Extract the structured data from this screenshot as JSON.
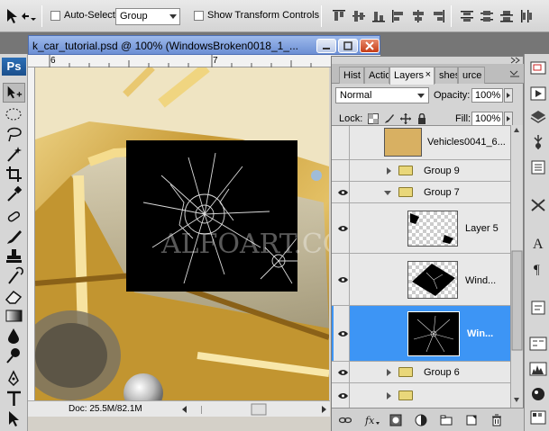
{
  "options_bar": {
    "auto_select_label": "Auto-Select:",
    "auto_select_value": "Group",
    "show_transform_label": "Show Transform Controls"
  },
  "toolbox": {
    "logo_text": "Ps"
  },
  "document": {
    "title": "k_car_tutorial.psd @ 100% (WindowsBroken0018_1_...",
    "ruler_marks": [
      "6",
      "7"
    ],
    "status": "Doc: 25.5M/82.1M",
    "watermark": "ALFOART.COM"
  },
  "panel": {
    "tabs": [
      "Hist",
      "Actio",
      "Layers",
      "shes",
      "urce"
    ],
    "blend_mode": "Normal",
    "opacity_label": "Opacity:",
    "opacity_value": "100%",
    "lock_label": "Lock:",
    "fill_label": "Fill:",
    "fill_value": "100%",
    "layers": [
      {
        "name": "Vehicles0041_6...",
        "visible": false,
        "kind": "layer"
      },
      {
        "name": "Group 9",
        "visible": false,
        "kind": "group",
        "expanded": false
      },
      {
        "name": "Group 7",
        "visible": true,
        "kind": "group",
        "expanded": true
      },
      {
        "name": "Layer 5",
        "visible": true,
        "kind": "layer"
      },
      {
        "name": "Wind...",
        "visible": true,
        "kind": "layer"
      },
      {
        "name": "Win...",
        "visible": true,
        "kind": "layer",
        "selected": true
      },
      {
        "name": "Group 6",
        "visible": true,
        "kind": "group",
        "expanded": false
      }
    ]
  },
  "colors": {
    "selection": "#3d95f5",
    "close_button": "#c53c17"
  }
}
